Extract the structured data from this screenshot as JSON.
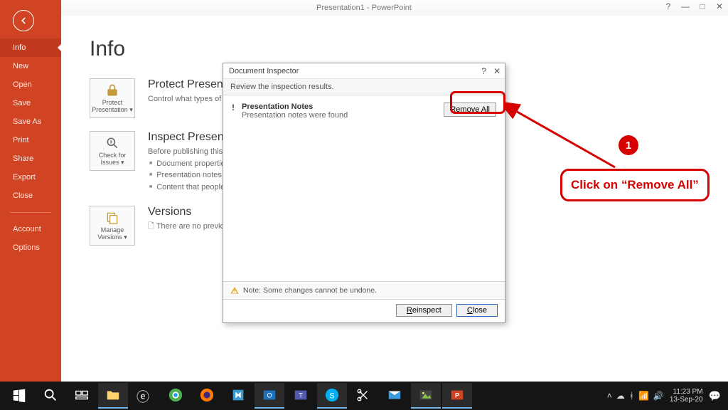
{
  "titlebar": {
    "title": "Presentation1 - PowerPoint"
  },
  "sidebar": {
    "items": [
      {
        "label": "Info",
        "selected": true
      },
      {
        "label": "New"
      },
      {
        "label": "Open"
      },
      {
        "label": "Save"
      },
      {
        "label": "Save As"
      },
      {
        "label": "Print"
      },
      {
        "label": "Share"
      },
      {
        "label": "Export"
      },
      {
        "label": "Close"
      }
    ],
    "footer_items": [
      {
        "label": "Account"
      },
      {
        "label": "Options"
      }
    ]
  },
  "main": {
    "heading": "Info",
    "sections": [
      {
        "tile": "Protect Presentation ▾",
        "title": "Protect Presenta",
        "desc": "Control what types of ch"
      },
      {
        "tile": "Check for Issues ▾",
        "title": "Inspect Presenta",
        "desc": "Before publishing this file",
        "bullets": [
          "Document properties",
          "Presentation notes",
          "Content that people"
        ]
      },
      {
        "tile": "Manage Versions ▾",
        "title": "Versions",
        "desc": "There are no previou"
      }
    ]
  },
  "dialog": {
    "title": "Document Inspector",
    "subhead": "Review the inspection results.",
    "result": {
      "mark": "!",
      "heading": "Presentation Notes",
      "detail": "Presentation notes were found"
    },
    "remove_all": "Remove All",
    "note": "Note: Some changes cannot be undone.",
    "reinspect": "Reinspect",
    "close": "Close",
    "help": "?",
    "x": "✕"
  },
  "annotation": {
    "badge": "1",
    "text": "Click on “Remove All”"
  },
  "taskbar": {
    "time": "11:23 PM",
    "date": "13-Sep-20"
  }
}
